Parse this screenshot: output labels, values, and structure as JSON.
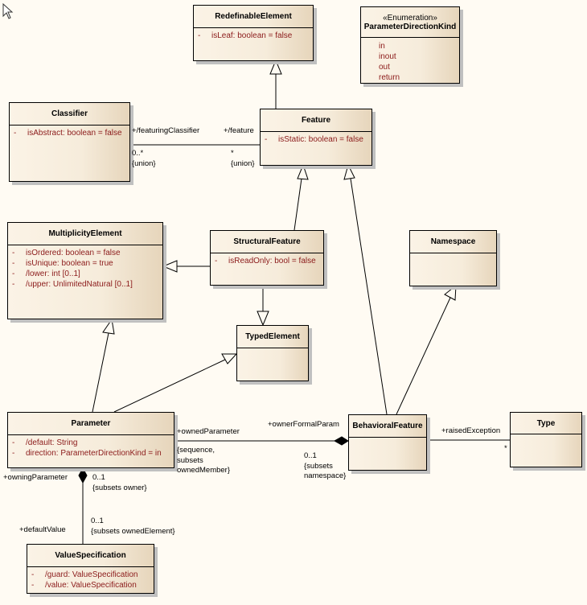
{
  "classes": {
    "redefinable": {
      "name": "RedefinableElement",
      "attributes": [
        {
          "vis": "-",
          "text": "isLeaf: boolean = false"
        }
      ]
    },
    "paramdir": {
      "stereotype": "«Enumeration»",
      "name": "ParameterDirectionKind",
      "literals": [
        "in",
        "inout",
        "out",
        "return"
      ]
    },
    "classifier": {
      "name": "Classifier",
      "attributes": [
        {
          "vis": "-",
          "text": "isAbstract: boolean = false"
        }
      ]
    },
    "feature": {
      "name": "Feature",
      "attributes": [
        {
          "vis": "-",
          "text": "isStatic: boolean = false"
        }
      ]
    },
    "multiplicity": {
      "name": "MultiplicityElement",
      "attributes": [
        {
          "vis": "-",
          "text": "isOrdered: boolean = false"
        },
        {
          "vis": "-",
          "text": "isUnique: boolean = true"
        },
        {
          "vis": "-",
          "text": "/lower: int [0..1]"
        },
        {
          "vis": "-",
          "text": "/upper: UnlimitedNatural [0..1]"
        }
      ]
    },
    "structural": {
      "name": "StructuralFeature",
      "attributes": [
        {
          "vis": "-",
          "text": "isReadOnly: bool = false"
        }
      ]
    },
    "namespace": {
      "name": "Namespace"
    },
    "typed": {
      "name": "TypedElement"
    },
    "parameter": {
      "name": "Parameter",
      "attributes": [
        {
          "vis": "-",
          "text": "/default: String"
        },
        {
          "vis": "-",
          "text": "direction: ParameterDirectionKind = in"
        }
      ]
    },
    "behavioral": {
      "name": "BehavioralFeature"
    },
    "type": {
      "name": "Type"
    },
    "valuespec": {
      "name": "ValueSpecification",
      "attributes": [
        {
          "vis": "-",
          "text": "/guard: ValueSpecification"
        },
        {
          "vis": "-",
          "text": "/value: ValueSpecification"
        }
      ]
    }
  },
  "labels": {
    "featuringClassifier": "+/featuringClassifier",
    "feature": "+/feature",
    "fc_mult": "0..*",
    "fc_union": "{union}",
    "f_mult": "*",
    "f_union": "{union}",
    "ownedParameter": "+ownedParameter",
    "op_c1": "{sequence,",
    "op_c2": "subsets",
    "op_c3": "ownedMember}",
    "ownerFormalParam": "+ownerFormalParam",
    "ofp_mult": "0..1",
    "ofp_c1": "{subsets",
    "ofp_c2": "namespace}",
    "raisedException": "+raisedException",
    "re_mult": "*",
    "owningParameter": "+owningParameter",
    "owp_mult": "0..1",
    "owp_c": "{subsets owner}",
    "defaultValue": "+defaultValue",
    "dv_mult": "0..1",
    "dv_c": "{subsets ownedElement}"
  }
}
